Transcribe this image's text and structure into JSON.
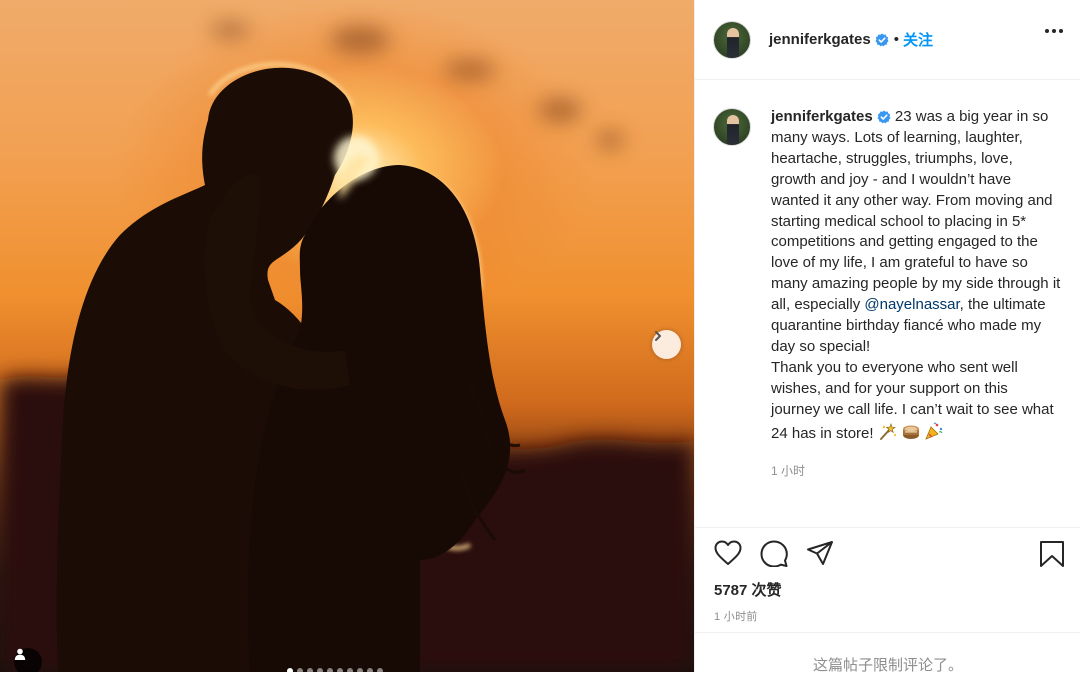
{
  "post": {
    "username": "jenniferkgates",
    "verified": true,
    "separator": "•",
    "follow_label": "关注",
    "caption": {
      "username": "jenniferkgates",
      "text_part1": " 23 was a big year in so many ways. Lots of learning, laughter, heartache, struggles, triumphs, love, growth and joy - and I wouldn’t have wanted it any other way. From moving and starting medical school to placing in 5* competitions and getting engaged to the love of my life, I am grateful to have so many amazing people by my side through it all, especially ",
      "mention": "@nayelnassar",
      "text_part2": ", the ultimate quarantine birthday fiancé who made my day so special!",
      "text_part3": "Thank you to everyone who sent well wishes, and for your support on this journey we call life. I can’t wait to see what 24 has in store! ",
      "emojis": [
        "sparkler-icon",
        "cake-icon",
        "party-popper-icon"
      ],
      "time": "1 小时"
    },
    "likes": "5787 次赞",
    "post_time": "1 小时前",
    "comments_limited": "这篇帖子限制评论了。",
    "carousel": {
      "slide_count": 10,
      "active_index": 0
    }
  },
  "colors": {
    "accent_blue": "#0095f6",
    "verified_blue": "#3897f0",
    "mention_blue": "#00376b",
    "muted_text": "#8e8e8e",
    "border": "#efefef"
  }
}
